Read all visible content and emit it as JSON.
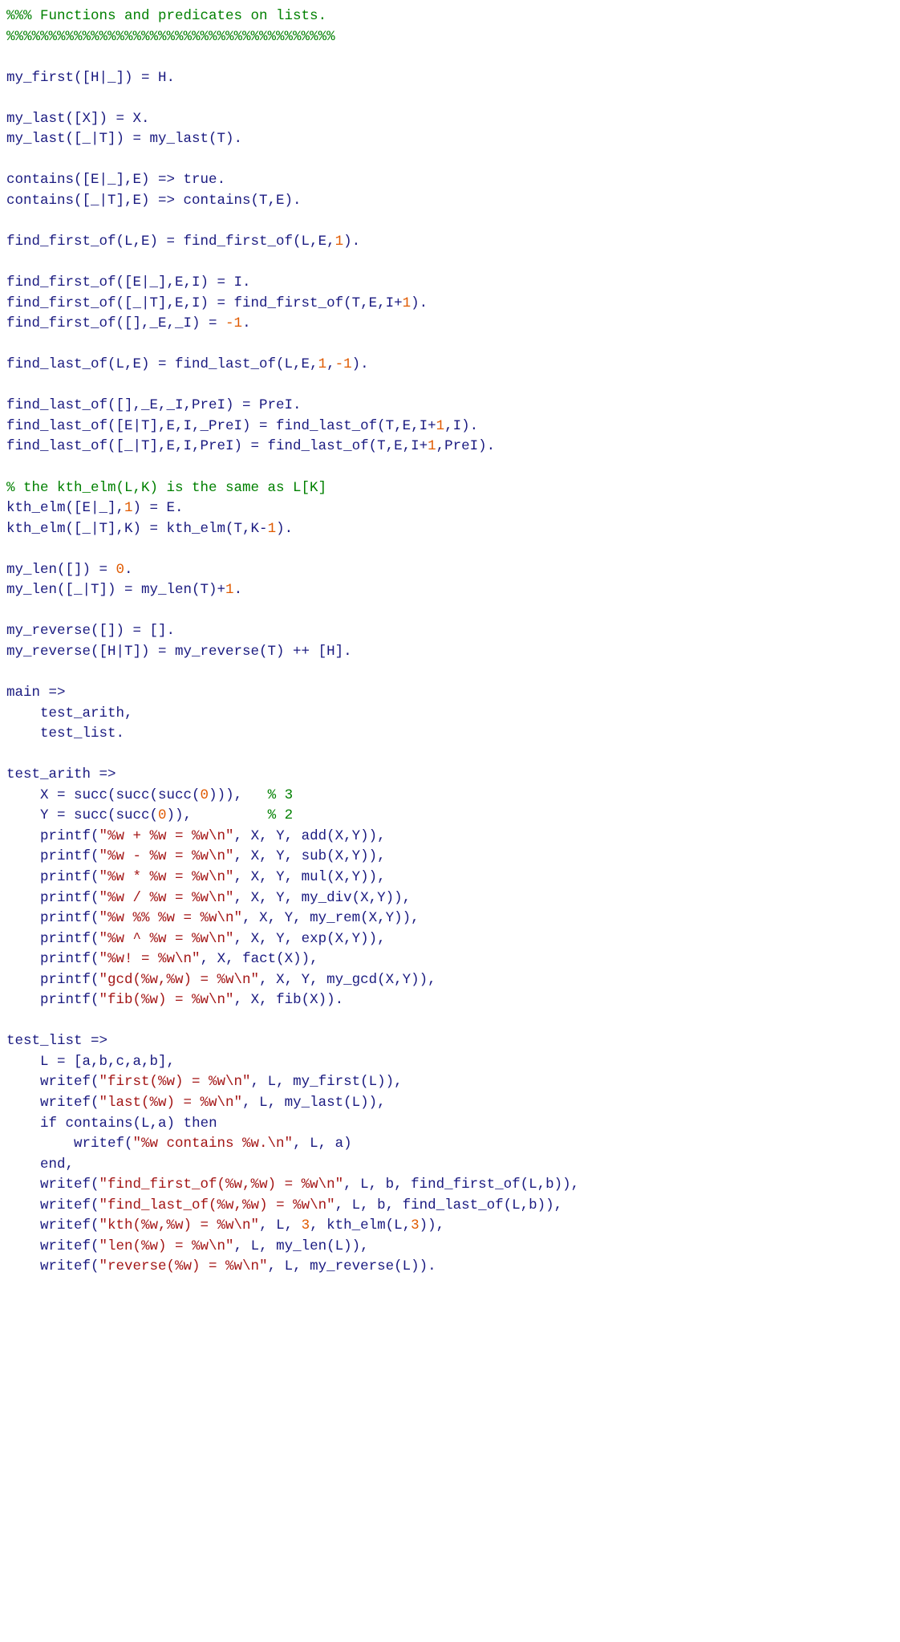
{
  "lines": [
    [
      {
        "cls": "comment",
        "t": "%%% Functions and predicates on lists."
      }
    ],
    [
      {
        "cls": "comment",
        "t": "%%%%%%%%%%%%%%%%%%%%%%%%%%%%%%%%%%%%%%%"
      }
    ],
    [],
    [
      {
        "cls": "blue",
        "t": "my_first([H|_]) = H."
      }
    ],
    [],
    [
      {
        "cls": "blue",
        "t": "my_last([X]) = X."
      }
    ],
    [
      {
        "cls": "blue",
        "t": "my_last([_|T]) = my_last(T)."
      }
    ],
    [],
    [
      {
        "cls": "blue",
        "t": "contains([E|_],E) => "
      },
      {
        "cls": "blue",
        "t": "true"
      },
      {
        "cls": "blue",
        "t": "."
      }
    ],
    [
      {
        "cls": "blue",
        "t": "contains([_|T],E) => contains(T,E)."
      }
    ],
    [],
    [
      {
        "cls": "blue",
        "t": "find_first_of(L,E) = find_first_of(L,E,"
      },
      {
        "cls": "num",
        "t": "1"
      },
      {
        "cls": "blue",
        "t": ")."
      }
    ],
    [],
    [
      {
        "cls": "blue",
        "t": "find_first_of([E|_],E,I) = I."
      }
    ],
    [
      {
        "cls": "blue",
        "t": "find_first_of([_|T],E,I) = find_first_of(T,E,I+"
      },
      {
        "cls": "num",
        "t": "1"
      },
      {
        "cls": "blue",
        "t": ")."
      }
    ],
    [
      {
        "cls": "blue",
        "t": "find_first_of([],_E,_I) = "
      },
      {
        "cls": "num",
        "t": "-1"
      },
      {
        "cls": "blue",
        "t": "."
      }
    ],
    [],
    [
      {
        "cls": "blue",
        "t": "find_last_of(L,E) = find_last_of(L,E,"
      },
      {
        "cls": "num",
        "t": "1"
      },
      {
        "cls": "blue",
        "t": ","
      },
      {
        "cls": "num",
        "t": "-1"
      },
      {
        "cls": "blue",
        "t": ")."
      }
    ],
    [],
    [
      {
        "cls": "blue",
        "t": "find_last_of([],_E,_I,PreI) = PreI."
      }
    ],
    [
      {
        "cls": "blue",
        "t": "find_last_of([E|T],E,I,_PreI) = find_last_of(T,E,I+"
      },
      {
        "cls": "num",
        "t": "1"
      },
      {
        "cls": "blue",
        "t": ",I)."
      }
    ],
    [
      {
        "cls": "blue",
        "t": "find_last_of([_|T],E,I,PreI) = find_last_of(T,E,I+"
      },
      {
        "cls": "num",
        "t": "1"
      },
      {
        "cls": "blue",
        "t": ",PreI)."
      }
    ],
    [],
    [
      {
        "cls": "comment",
        "t": "% the kth_elm(L,K) is the same as L[K]"
      }
    ],
    [
      {
        "cls": "blue",
        "t": "kth_elm([E|_],"
      },
      {
        "cls": "num",
        "t": "1"
      },
      {
        "cls": "blue",
        "t": ") = E."
      }
    ],
    [
      {
        "cls": "blue",
        "t": "kth_elm([_|T],K) = kth_elm(T,K-"
      },
      {
        "cls": "num",
        "t": "1"
      },
      {
        "cls": "blue",
        "t": ")."
      }
    ],
    [],
    [
      {
        "cls": "blue",
        "t": "my_len([]) = "
      },
      {
        "cls": "num",
        "t": "0"
      },
      {
        "cls": "blue",
        "t": "."
      }
    ],
    [
      {
        "cls": "blue",
        "t": "my_len([_|T]) = my_len(T)+"
      },
      {
        "cls": "num",
        "t": "1"
      },
      {
        "cls": "blue",
        "t": "."
      }
    ],
    [],
    [
      {
        "cls": "blue",
        "t": "my_reverse([]) = []."
      }
    ],
    [
      {
        "cls": "blue",
        "t": "my_reverse([H|T]) = my_reverse(T) ++ [H]."
      }
    ],
    [],
    [
      {
        "cls": "blue",
        "t": "main =>"
      }
    ],
    [
      {
        "cls": "blue",
        "t": "    test_arith,"
      }
    ],
    [
      {
        "cls": "blue",
        "t": "    test_list."
      }
    ],
    [],
    [
      {
        "cls": "blue",
        "t": "test_arith =>"
      }
    ],
    [
      {
        "cls": "blue",
        "t": "    X = succ(succ(succ("
      },
      {
        "cls": "num",
        "t": "0"
      },
      {
        "cls": "blue",
        "t": "))),   "
      },
      {
        "cls": "comment",
        "t": "% 3"
      }
    ],
    [
      {
        "cls": "blue",
        "t": "    Y = succ(succ("
      },
      {
        "cls": "num",
        "t": "0"
      },
      {
        "cls": "blue",
        "t": ")),         "
      },
      {
        "cls": "comment",
        "t": "% 2"
      }
    ],
    [
      {
        "cls": "blue",
        "t": "    printf("
      },
      {
        "cls": "str",
        "t": "\"%w + %w = %w\\n\""
      },
      {
        "cls": "blue",
        "t": ", X, Y, add(X,Y)),"
      }
    ],
    [
      {
        "cls": "blue",
        "t": "    printf("
      },
      {
        "cls": "str",
        "t": "\"%w - %w = %w\\n\""
      },
      {
        "cls": "blue",
        "t": ", X, Y, sub(X,Y)),"
      }
    ],
    [
      {
        "cls": "blue",
        "t": "    printf("
      },
      {
        "cls": "str",
        "t": "\"%w * %w = %w\\n\""
      },
      {
        "cls": "blue",
        "t": ", X, Y, mul(X,Y)),"
      }
    ],
    [
      {
        "cls": "blue",
        "t": "    printf("
      },
      {
        "cls": "str",
        "t": "\"%w / %w = %w\\n\""
      },
      {
        "cls": "blue",
        "t": ", X, Y, my_div(X,Y)),"
      }
    ],
    [
      {
        "cls": "blue",
        "t": "    printf("
      },
      {
        "cls": "str",
        "t": "\"%w %% %w = %w\\n\""
      },
      {
        "cls": "blue",
        "t": ", X, Y, my_rem(X,Y)),"
      }
    ],
    [
      {
        "cls": "blue",
        "t": "    printf("
      },
      {
        "cls": "str",
        "t": "\"%w ^ %w = %w\\n\""
      },
      {
        "cls": "blue",
        "t": ", X, Y, exp(X,Y)),"
      }
    ],
    [
      {
        "cls": "blue",
        "t": "    printf("
      },
      {
        "cls": "str",
        "t": "\"%w! = %w\\n\""
      },
      {
        "cls": "blue",
        "t": ", X, fact(X)),"
      }
    ],
    [
      {
        "cls": "blue",
        "t": "    printf("
      },
      {
        "cls": "str",
        "t": "\"gcd(%w,%w) = %w\\n\""
      },
      {
        "cls": "blue",
        "t": ", X, Y, my_gcd(X,Y)),"
      }
    ],
    [
      {
        "cls": "blue",
        "t": "    printf("
      },
      {
        "cls": "str",
        "t": "\"fib(%w) = %w\\n\""
      },
      {
        "cls": "blue",
        "t": ", X, fib(X))."
      }
    ],
    [],
    [
      {
        "cls": "blue",
        "t": "test_list =>"
      }
    ],
    [
      {
        "cls": "blue",
        "t": "    L = [a,b,c,a,b],"
      }
    ],
    [
      {
        "cls": "blue",
        "t": "    writef("
      },
      {
        "cls": "str",
        "t": "\"first(%w) = %w\\n\""
      },
      {
        "cls": "blue",
        "t": ", L, my_first(L)),"
      }
    ],
    [
      {
        "cls": "blue",
        "t": "    writef("
      },
      {
        "cls": "str",
        "t": "\"last(%w) = %w\\n\""
      },
      {
        "cls": "blue",
        "t": ", L, my_last(L)),"
      }
    ],
    [
      {
        "cls": "blue",
        "t": "    "
      },
      {
        "cls": "blue",
        "t": "if"
      },
      {
        "cls": "blue",
        "t": " contains(L,a) "
      },
      {
        "cls": "blue",
        "t": "then"
      }
    ],
    [
      {
        "cls": "blue",
        "t": "        writef("
      },
      {
        "cls": "str",
        "t": "\"%w contains %w.\\n\""
      },
      {
        "cls": "blue",
        "t": ", L, a)"
      }
    ],
    [
      {
        "cls": "blue",
        "t": "    "
      },
      {
        "cls": "blue",
        "t": "end"
      },
      {
        "cls": "blue",
        "t": ","
      }
    ],
    [
      {
        "cls": "blue",
        "t": "    writef("
      },
      {
        "cls": "str",
        "t": "\"find_first_of(%w,%w) = %w\\n\""
      },
      {
        "cls": "blue",
        "t": ", L, b, find_first_of(L,b)),"
      }
    ],
    [
      {
        "cls": "blue",
        "t": "    writef("
      },
      {
        "cls": "str",
        "t": "\"find_last_of(%w,%w) = %w\\n\""
      },
      {
        "cls": "blue",
        "t": ", L, b, find_last_of(L,b)),"
      }
    ],
    [
      {
        "cls": "blue",
        "t": "    writef("
      },
      {
        "cls": "str",
        "t": "\"kth(%w,%w) = %w\\n\""
      },
      {
        "cls": "blue",
        "t": ", L, "
      },
      {
        "cls": "num",
        "t": "3"
      },
      {
        "cls": "blue",
        "t": ", kth_elm(L,"
      },
      {
        "cls": "num",
        "t": "3"
      },
      {
        "cls": "blue",
        "t": ")),"
      }
    ],
    [
      {
        "cls": "blue",
        "t": "    writef("
      },
      {
        "cls": "str",
        "t": "\"len(%w) = %w\\n\""
      },
      {
        "cls": "blue",
        "t": ", L, my_len(L)),"
      }
    ],
    [
      {
        "cls": "blue",
        "t": "    writef("
      },
      {
        "cls": "str",
        "t": "\"reverse(%w) = %w\\n\""
      },
      {
        "cls": "blue",
        "t": ", L, my_reverse(L))."
      }
    ]
  ]
}
